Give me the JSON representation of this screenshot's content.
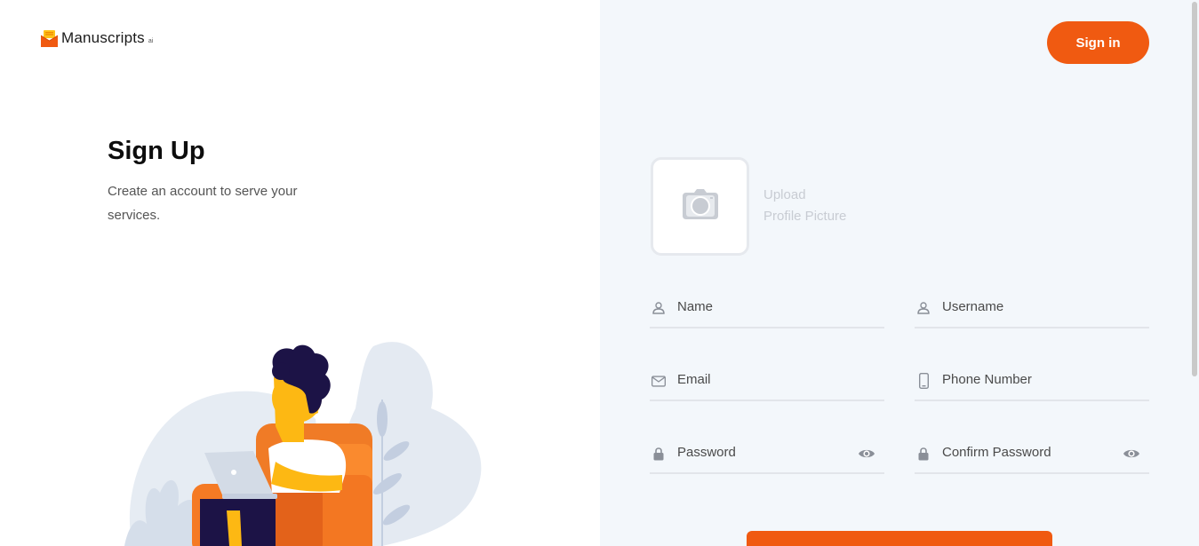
{
  "brand": {
    "name": "Manuscripts",
    "suffix": "ai"
  },
  "intro": {
    "title": "Sign Up",
    "subtitle": "Create an account to serve your services."
  },
  "header": {
    "signin_label": "Sign in"
  },
  "upload": {
    "line1": "Upload",
    "line2": "Profile Picture"
  },
  "form": {
    "name_placeholder": "Name",
    "username_placeholder": "Username",
    "email_placeholder": "Email",
    "phone_placeholder": "Phone Number",
    "password_placeholder": "Password",
    "confirm_password_placeholder": "Confirm Password"
  },
  "icons": {
    "logo": "envelope-logo-icon",
    "upload": "camera-icon",
    "name": "user-icon",
    "username": "user-icon",
    "email": "mail-icon",
    "phone": "phone-icon",
    "password": "lock-icon",
    "confirm_password": "lock-icon",
    "toggle": "eye-icon"
  },
  "colors": {
    "accent": "#f05a11",
    "panel": "#f3f7fb",
    "input_line": "#e2e5ea"
  }
}
